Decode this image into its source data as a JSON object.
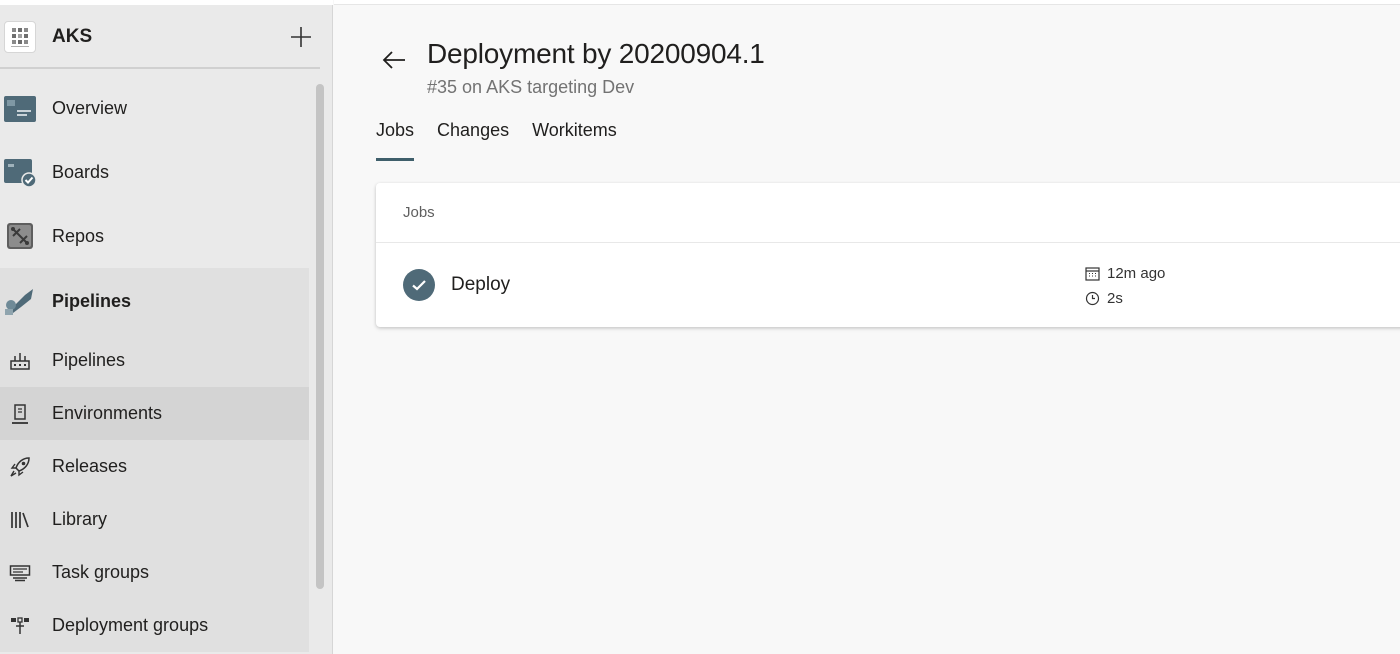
{
  "project": {
    "name": "AKS"
  },
  "sidebar": {
    "items": [
      {
        "label": "Overview"
      },
      {
        "label": "Boards"
      },
      {
        "label": "Repos"
      }
    ],
    "pipelines_group": {
      "label": "Pipelines",
      "children": [
        {
          "label": "Pipelines"
        },
        {
          "label": "Environments",
          "selected": true
        },
        {
          "label": "Releases"
        },
        {
          "label": "Library"
        },
        {
          "label": "Task groups"
        },
        {
          "label": "Deployment groups"
        }
      ]
    }
  },
  "header": {
    "title": "Deployment by 20200904.1",
    "subtitle": "#35 on AKS targeting Dev"
  },
  "tabs": [
    {
      "label": "Jobs",
      "active": true
    },
    {
      "label": "Changes"
    },
    {
      "label": "Workitems"
    }
  ],
  "jobs_card": {
    "header": "Jobs",
    "rows": [
      {
        "name": "Deploy",
        "status": "succeeded",
        "time_ago": "12m ago",
        "duration": "2s"
      }
    ]
  },
  "colors": {
    "accent": "#3f5f6b",
    "status_success": "#4f6a78",
    "sidebar_bg": "#eaeaea",
    "selected_bg": "#d4d4d4"
  },
  "icons": {
    "overview": "overview-icon",
    "boards": "boards-icon",
    "repos": "repos-icon",
    "pipelines": "pipelines-icon",
    "environments": "environments-icon",
    "releases": "rocket-icon",
    "library": "library-icon",
    "task_groups": "task-groups-icon",
    "deployment_groups": "deployment-groups-icon"
  }
}
